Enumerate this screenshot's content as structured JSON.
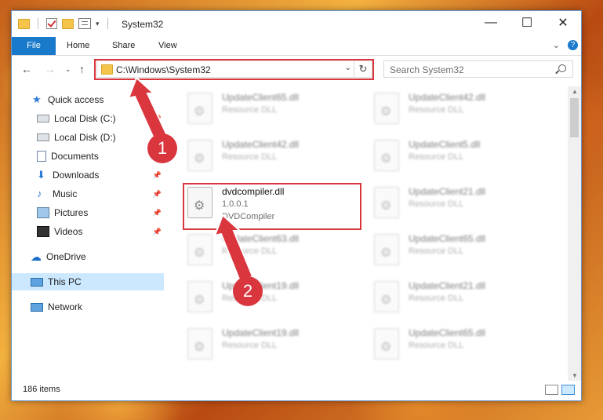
{
  "window": {
    "title": "System32"
  },
  "ribbon": {
    "tabs": [
      "File",
      "Home",
      "Share",
      "View"
    ],
    "help": "?"
  },
  "address_bar": {
    "path": "C:\\Windows\\System32"
  },
  "search": {
    "placeholder": "Search System32"
  },
  "sidebar": {
    "items": [
      {
        "label": "Quick access",
        "icon": "star-icon"
      },
      {
        "label": "Local Disk (C:)",
        "icon": "drive-icon"
      },
      {
        "label": "Local Disk (D:)",
        "icon": "drive-icon"
      },
      {
        "label": "Documents",
        "icon": "documents-icon"
      },
      {
        "label": "Downloads",
        "icon": "download-icon"
      },
      {
        "label": "Music",
        "icon": "music-icon"
      },
      {
        "label": "Pictures",
        "icon": "pictures-icon"
      },
      {
        "label": "Videos",
        "icon": "videos-icon"
      },
      {
        "label": "OneDrive",
        "icon": "cloud-icon"
      },
      {
        "label": "This PC",
        "icon": "pc-icon",
        "selected": true
      },
      {
        "label": "Network",
        "icon": "network-icon"
      }
    ]
  },
  "files": [
    {
      "name": "UpdateClient65.dll",
      "type": "Resource DLL"
    },
    {
      "name": "UpdateClient42.dll",
      "type": "Resource DLL"
    },
    {
      "name": "UpdateClient42.dll",
      "type": "Resource DLL"
    },
    {
      "name": "UpdateClient5.dll",
      "type": "Resource DLL"
    },
    {
      "name": "dvdcompiler.dll",
      "version": "1.0.0.1",
      "description": "DVDCompiler"
    },
    {
      "name": "UpdateClient21.dll",
      "type": "Resource DLL"
    },
    {
      "name": "UpdateClient63.dll",
      "type": "Resource DLL"
    },
    {
      "name": "UpdateClient65.dll",
      "type": "Resource DLL"
    },
    {
      "name": "UpdateClient19.dll",
      "type": "Resource DLL"
    },
    {
      "name": "UpdateClient21.dll",
      "type": "Resource DLL"
    },
    {
      "name": "UpdateClient19.dll",
      "type": "Resource DLL"
    },
    {
      "name": "UpdateClient65.dll",
      "type": "Resource DLL"
    }
  ],
  "status": {
    "item_count": "186 items"
  },
  "annotations": {
    "badge1": "1",
    "badge2": "2",
    "color": "#d9363e"
  }
}
